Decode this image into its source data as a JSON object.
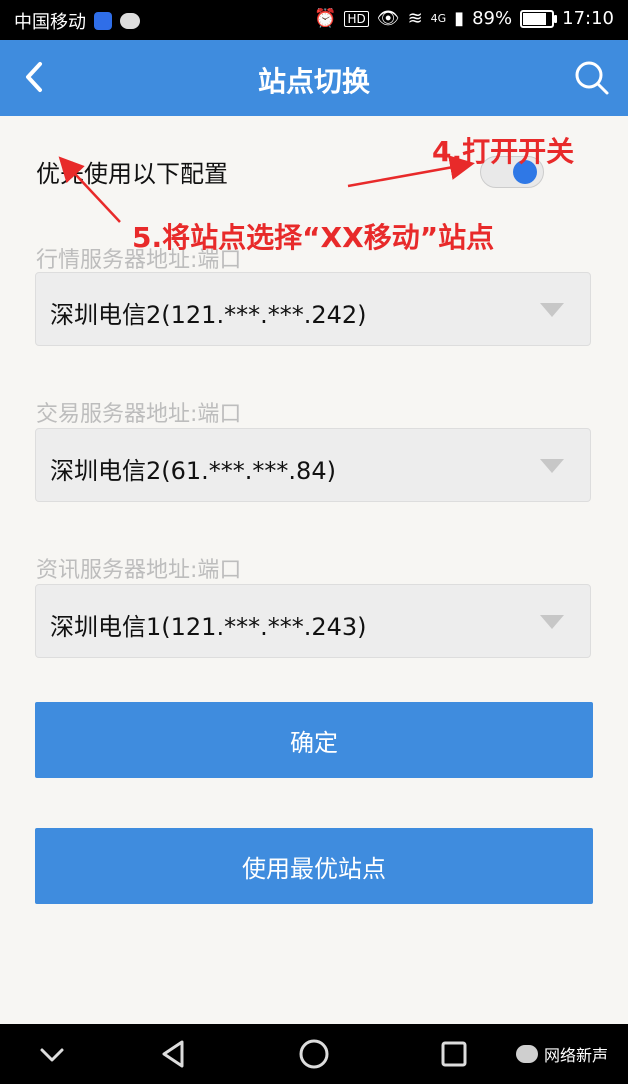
{
  "status_bar": {
    "carrier": "中国移动",
    "network": "4G",
    "battery": "89%",
    "battery_level": 0.89,
    "time": "17:10",
    "hd_badge": "HD"
  },
  "header": {
    "title": "站点切换",
    "back_icon": "chevron-left-icon",
    "search_icon": "search-icon"
  },
  "preferences": {
    "use_config_label": "优先使用以下配置",
    "toggle_on": true
  },
  "servers": [
    {
      "label": "行情服务器地址:端口",
      "value": "深圳电信2(121.***.***.242)"
    },
    {
      "label": "交易服务器地址:端口",
      "value": "深圳电信2(61.***.***.84)"
    },
    {
      "label": "资讯服务器地址:端口",
      "value": "深圳电信1(121.***.***.243)"
    }
  ],
  "buttons": {
    "confirm": "确定",
    "use_best": "使用最优站点"
  },
  "annotations": {
    "step4": "4.打开开关",
    "step5": "5.将站点选择“XX移动”站点"
  },
  "nav_bar": {
    "brand": "网络新声"
  },
  "colors": {
    "primary": "#3f8cde",
    "annotation": "#e82a2a"
  }
}
